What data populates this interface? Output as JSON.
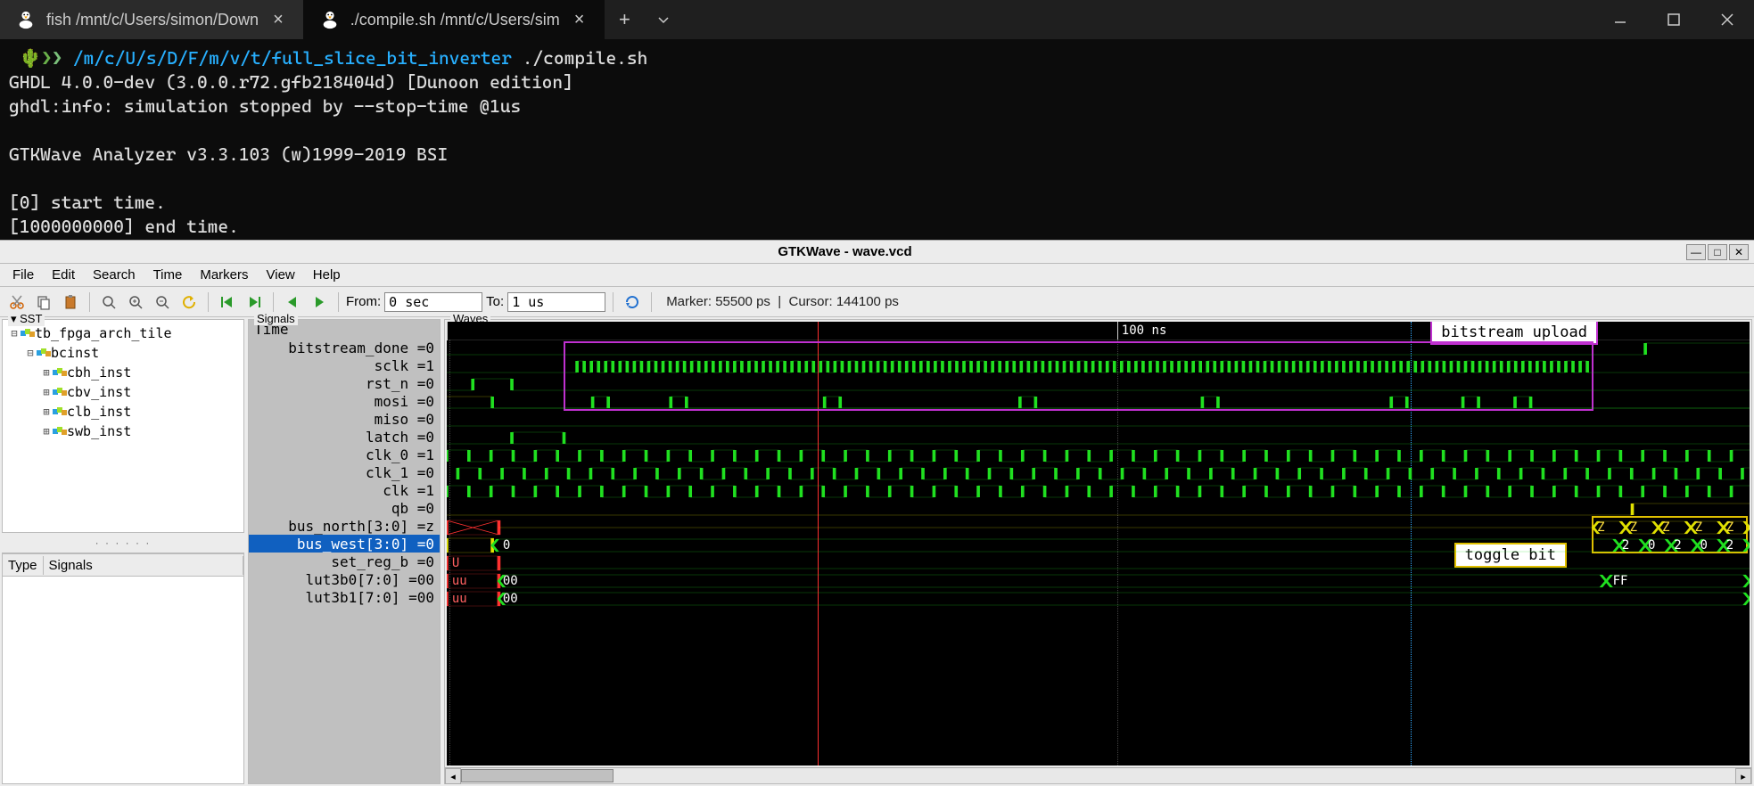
{
  "terminal": {
    "tabs": [
      {
        "icon": "tux-icon",
        "label": "fish /mnt/c/Users/simon/Down",
        "active": false
      },
      {
        "icon": "tux-icon",
        "label": "./compile.sh /mnt/c/Users/sim",
        "active": true
      }
    ],
    "prompt_path": "/m/c/U/s/D/F/m/v/t/full_slice_bit_inverter",
    "prompt_cmd": "./compile.sh",
    "lines": [
      "GHDL 4.0.0-dev (3.0.0.r72.gfb218404d) [Dunoon edition]",
      "ghdl:info: simulation stopped by --stop-time @1us",
      "",
      "GTKWave Analyzer v3.3.103 (w)1999-2019 BSI",
      "",
      "[0] start time.",
      "[1000000000] end time."
    ]
  },
  "gtkwave": {
    "title": "GTKWave - wave.vcd",
    "menu": [
      "File",
      "Edit",
      "Search",
      "Time",
      "Markers",
      "View",
      "Help"
    ],
    "toolbar": {
      "from_label": "From:",
      "from_value": "0 sec",
      "to_label": "To:",
      "to_value": "1 us",
      "marker": "Marker: 55500 ps",
      "cursor": "Cursor: 144100 ps"
    },
    "sst": {
      "legend": "SST",
      "tree": [
        {
          "level": 0,
          "expander": "⊟",
          "label": "tb_fpga_arch_tile"
        },
        {
          "level": 1,
          "expander": "⊟",
          "label": "bcinst"
        },
        {
          "level": 2,
          "expander": "⊞",
          "label": "cbh_inst"
        },
        {
          "level": 2,
          "expander": "⊞",
          "label": "cbv_inst"
        },
        {
          "level": 2,
          "expander": "⊞",
          "label": "clb_inst"
        },
        {
          "level": 2,
          "expander": "⊞",
          "label": "swb_inst"
        }
      ],
      "filter_cols": [
        "Type",
        "Signals"
      ]
    },
    "signals": {
      "legend": "Signals",
      "header": "Time",
      "rows": [
        {
          "text": "bitstream_done =0",
          "sel": false
        },
        {
          "text": "sclk =1",
          "sel": false
        },
        {
          "text": "rst_n =0",
          "sel": false
        },
        {
          "text": "mosi =0",
          "sel": false
        },
        {
          "text": "miso =0",
          "sel": false
        },
        {
          "text": "latch =0",
          "sel": false
        },
        {
          "text": "clk_0 =1",
          "sel": false
        },
        {
          "text": "clk_1 =0",
          "sel": false
        },
        {
          "text": "clk =1",
          "sel": false
        },
        {
          "text": "qb =0",
          "sel": false
        },
        {
          "text": "bus_north[3:0] =z",
          "sel": false
        },
        {
          "text": "bus_west[3:0] =0",
          "sel": true
        },
        {
          "text": "set_reg_b =0",
          "sel": false
        },
        {
          "text": "lut3b0[7:0] =00",
          "sel": false
        },
        {
          "text": "lut3b1[7:0] =00",
          "sel": false
        }
      ]
    },
    "waves": {
      "legend": "Waves",
      "time_tick_label": "100 ns",
      "annotations": {
        "bitstream": "bitstream upload",
        "toggle": "toggle bit"
      },
      "bus_labels": {
        "bus_north_z": "Z",
        "bus_west_0": "0",
        "bus_west_2": "2",
        "set_reg_U": "U",
        "lut_uu": "uu",
        "lut_00": "00",
        "lut_FF": "FF"
      }
    }
  }
}
